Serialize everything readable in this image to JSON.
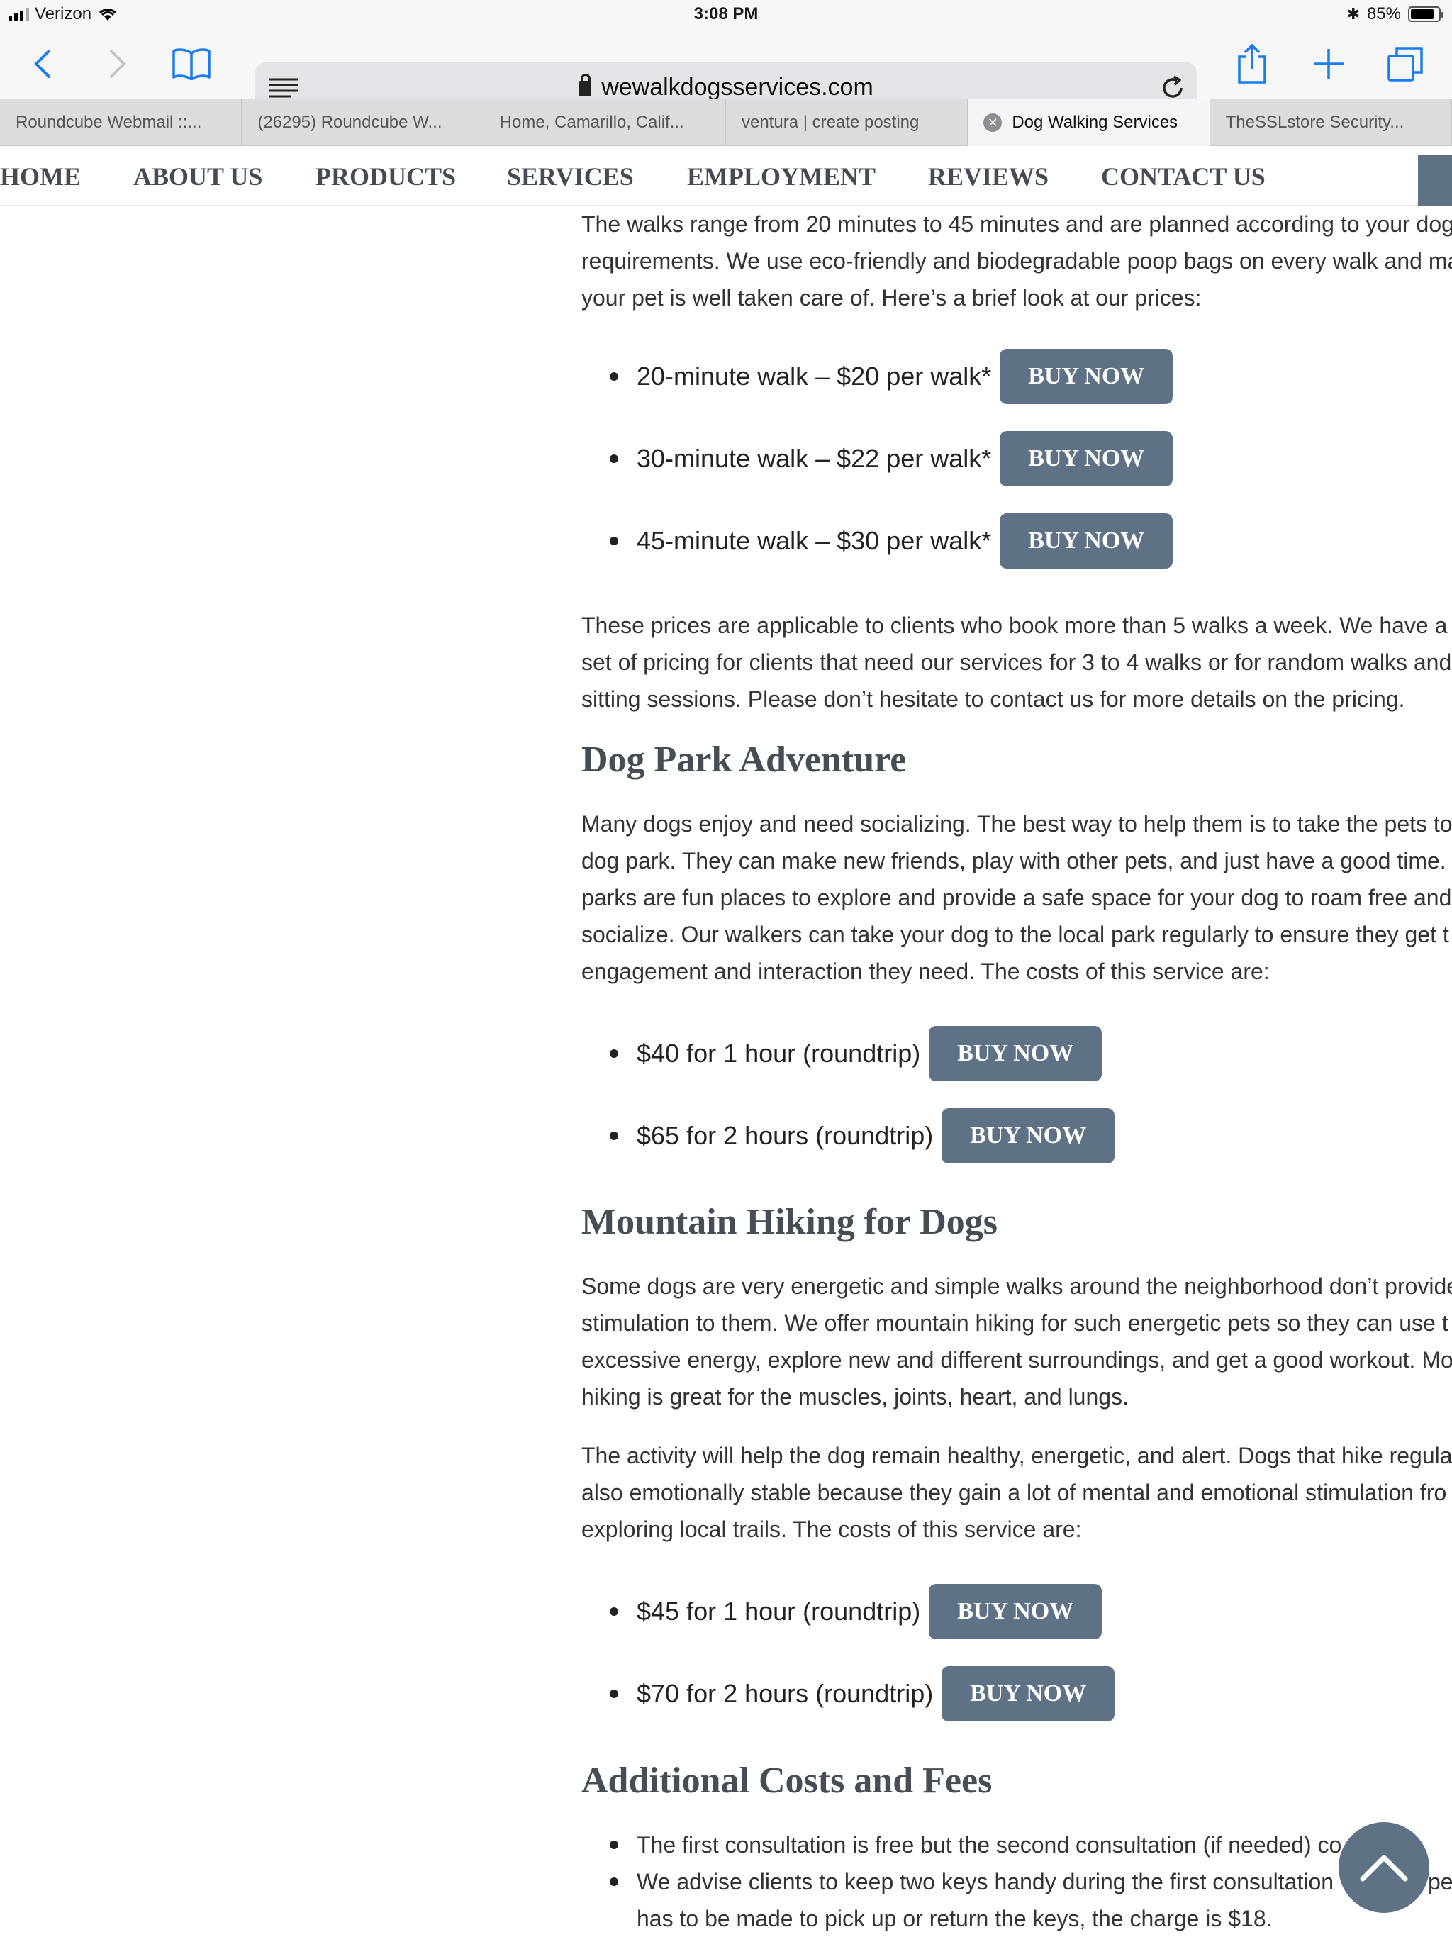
{
  "status": {
    "carrier": "Verizon",
    "time": "3:08 PM",
    "battery": "85%",
    "battery_level": 0.85
  },
  "toolbar": {
    "url": "wewalkdogsservices.com"
  },
  "tabs": [
    {
      "label": "Roundcube Webmail ::..."
    },
    {
      "label": "(26295) Roundcube W..."
    },
    {
      "label": "Home, Camarillo, Calif..."
    },
    {
      "label": "ventura | create posting"
    },
    {
      "label": "Dog Walking Services"
    },
    {
      "label": "TheSSLstore Security..."
    }
  ],
  "nav": {
    "home": "HOME",
    "about": "ABOUT US",
    "products": "PRODUCTS",
    "services": "SERVICES",
    "employment": "EMPLOYMENT",
    "reviews": "REVIEWS",
    "contact": "CONTACT US"
  },
  "walks": {
    "intro": [
      "The walks range from 20 minutes to 45 minutes and are planned according to your dog",
      "requirements. We use eco-friendly and biodegradable poop bags on every walk and ma",
      "your pet is well taken care of. Here’s a brief look at our prices:"
    ],
    "items": [
      {
        "label": "20-minute walk – $20 per walk*",
        "button": "BUY NOW"
      },
      {
        "label": "30-minute walk – $22 per walk*",
        "button": "BUY NOW"
      },
      {
        "label": "45-minute walk – $30 per walk*",
        "button": "BUY NOW"
      }
    ],
    "note": [
      "These prices are applicable to clients who book more than 5 walks a week. We have a",
      "set of pricing for clients that need our services for 3 to 4 walks or for random walks and",
      "sitting sessions. Please don’t hesitate to contact us for more details on the pricing."
    ]
  },
  "park": {
    "heading": "Dog Park Adventure",
    "body": [
      "Many dogs enjoy and need socializing. The best way to help them is to take the pets to",
      "dog park. They can make new friends, play with other pets, and just have a good time.",
      "parks are fun places to explore and provide a safe space for your dog to roam free and",
      "socialize. Our walkers can take your dog to the local park regularly to ensure they get t",
      "engagement and interaction they need. The costs of this service are:"
    ],
    "items": [
      {
        "label": "$40 for 1 hour (roundtrip)",
        "button": "BUY NOW"
      },
      {
        "label": "$65 for 2 hours (roundtrip)",
        "button": "BUY NOW"
      }
    ]
  },
  "hiking": {
    "heading": "Mountain Hiking for Dogs",
    "body1": [
      "Some dogs are very energetic and simple walks around the neighborhood don’t provide",
      "stimulation to them. We offer mountain hiking for such energetic pets so they can use t",
      "excessive energy, explore new and different surroundings, and get a good workout. Mo",
      "hiking is great for the muscles, joints, heart, and lungs."
    ],
    "body2": [
      "The activity will help the dog remain healthy, energetic, and alert. Dogs that hike regula",
      "also emotionally stable because they gain a lot of mental and emotional stimulation fro",
      "exploring local trails. The costs of this service are:"
    ],
    "items": [
      {
        "label": "$45 for 1 hour (roundtrip)",
        "button": "BUY NOW"
      },
      {
        "label": "$70 for 2 hours (roundtrip)",
        "button": "BUY NOW"
      }
    ]
  },
  "fees": {
    "heading": "Additional Costs and Fees",
    "items": [
      {
        "lines": [
          "The first consultation is free but the second consultation (if needed) co"
        ]
      },
      {
        "lines": [
          "We advise clients to keep two keys handy during the first consultation",
          "has to be made to pick up or return the keys, the charge is $18."
        ],
        "trail": "pe"
      }
    ]
  }
}
